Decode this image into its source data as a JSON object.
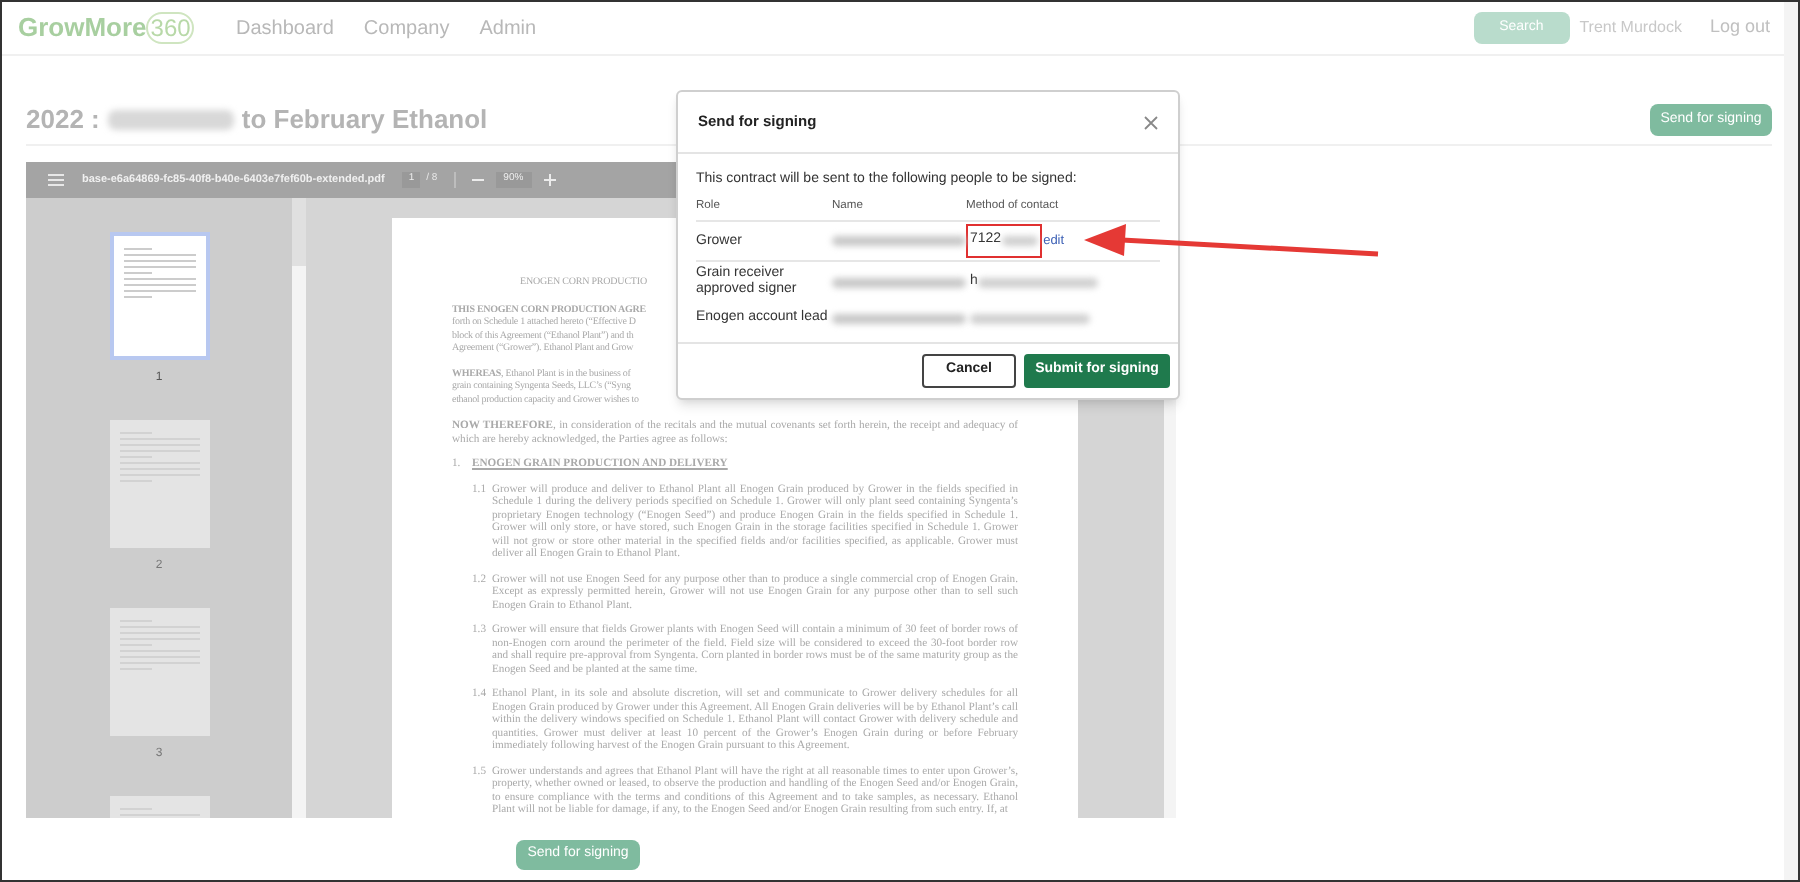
{
  "navbar": {
    "logo": {
      "word": "GrowMore",
      "number": "360"
    },
    "links": [
      {
        "label": "Dashboard"
      },
      {
        "label": "Company"
      },
      {
        "label": "Admin"
      }
    ],
    "search_button": "Search",
    "user": "Trent Murdock",
    "logout": "Log out"
  },
  "page": {
    "title_start": "2022 :",
    "title_end": "to February Ethanol",
    "send_button": "Send for signing"
  },
  "pdf_viewer": {
    "filename": "base-e6a64869-fc85-40f8-b40e-6403e7fef60b-extended.pdf",
    "page": "1",
    "page_total": "/ 8",
    "zoom": "90%",
    "thumbnails": [
      {
        "label": "1",
        "selected": true
      },
      {
        "label": "2",
        "selected": false
      },
      {
        "label": "3",
        "selected": false
      },
      {
        "selected": false
      }
    ],
    "document": {
      "heading": "ENOGEN CORN PRODUCTIO",
      "intro_lines": [
        "THIS ENOGEN CORN PRODUCTION AGRE",
        "forth on Schedule 1 attached hereto (“Effective D",
        "block of this Agreement (“Ethanol Plant”) and th",
        "Agreement (“Grower”).  Ethanol Plant and Grow"
      ],
      "whereas_lines": [
        "**WHEREAS**, Ethanol Plant is in the business of",
        "grain containing Syngenta Seeds, LLC’s (“Syng",
        "ethanol production capacity and Grower wishes to"
      ],
      "now_therefore": "**NOW THEREFORE**, in consideration of the recitals and the mutual covenants set forth herein, the receipt and adequacy of which are hereby acknowledged, the Parties agree as follows:",
      "section": {
        "number": "1.",
        "title": "ENOGEN GRAIN PRODUCTION AND DELIVERY"
      },
      "clauses": [
        {
          "number": "1.1",
          "text": "Grower will produce and deliver to Ethanol Plant all Enogen Grain produced by Grower in the fields specified in Schedule 1 during the delivery periods specified on Schedule 1. Grower will only plant seed containing Syngenta’s proprietary Enogen technology (“Enogen Seed”) and produce Enogen Grain in the fields specified in Schedule 1. Grower will only store, or have stored, such Enogen Grain in the storage facilities specified in Schedule 1.  Grower will not grow or store other material in the specified fields and/or facilities specified, as applicable.  Grower must deliver all Enogen Grain to Ethanol Plant."
        },
        {
          "number": "1.2",
          "text": "Grower will not use Enogen Seed for any purpose other than to produce a single commercial crop of Enogen Grain. Except as expressly permitted herein, Grower will not use Enogen Grain for any purpose other than to sell such Enogen Grain to Ethanol Plant."
        },
        {
          "number": "1.3",
          "text": "Grower will ensure that fields Grower plants with Enogen Seed will contain a minimum of 30 feet of border rows of non-Enogen corn around the perimeter of the field.  Field size will be considered to exceed the 30-foot border row and shall require pre-approval from Syngenta. Corn planted in border rows must be of the same maturity group as the Enogen Seed and be planted at the same time."
        },
        {
          "number": "1.4",
          "text": "Ethanol Plant, in its sole and absolute discretion, will set and communicate to Grower delivery schedules for all Enogen Grain produced by Grower under this Agreement.  All Enogen Grain deliveries will be by Ethanol Plant’s call within the delivery windows specified on Schedule 1.  Ethanol Plant will contact Grower with delivery schedule and quantities.   Grower must deliver at least 10 percent of the Grower’s Enogen Grain during or before February immediately following harvest of the Enogen Grain pursuant to this Agreement."
        },
        {
          "number": "1.5",
          "text": "Grower understands and agrees that Ethanol Plant will have the right at all reasonable times to enter upon Grower’s, property, whether owned or leased, to observe the production and handling of the Enogen Seed and/or Enogen Grain, to ensure compliance with the terms and conditions of this Agreement and to take samples, as necessary.  Ethanol Plant will not be liable for damage, if any, to the Enogen Seed and/or Enogen Grain resulting from such entry.  If, at"
        }
      ]
    }
  },
  "bottom_button": "Send for signing",
  "dialog": {
    "title": "Send for signing",
    "intro": "This contract will be sent to the following people to be signed:",
    "columns": [
      "Role",
      "Name",
      "Method of contact"
    ],
    "rows": [
      {
        "role": "Grower",
        "contact": "7122",
        "highlighted": true,
        "action": "edit"
      },
      {
        "role": "Grain receiver approved signer",
        "contact": "h",
        "highlighted": false
      },
      {
        "role": "Enogen account lead",
        "highlighted": false
      }
    ],
    "buttons": [
      {
        "label": "Cancel",
        "kind": "secondary"
      },
      {
        "label": "Submit for signing",
        "kind": "primary"
      }
    ]
  }
}
